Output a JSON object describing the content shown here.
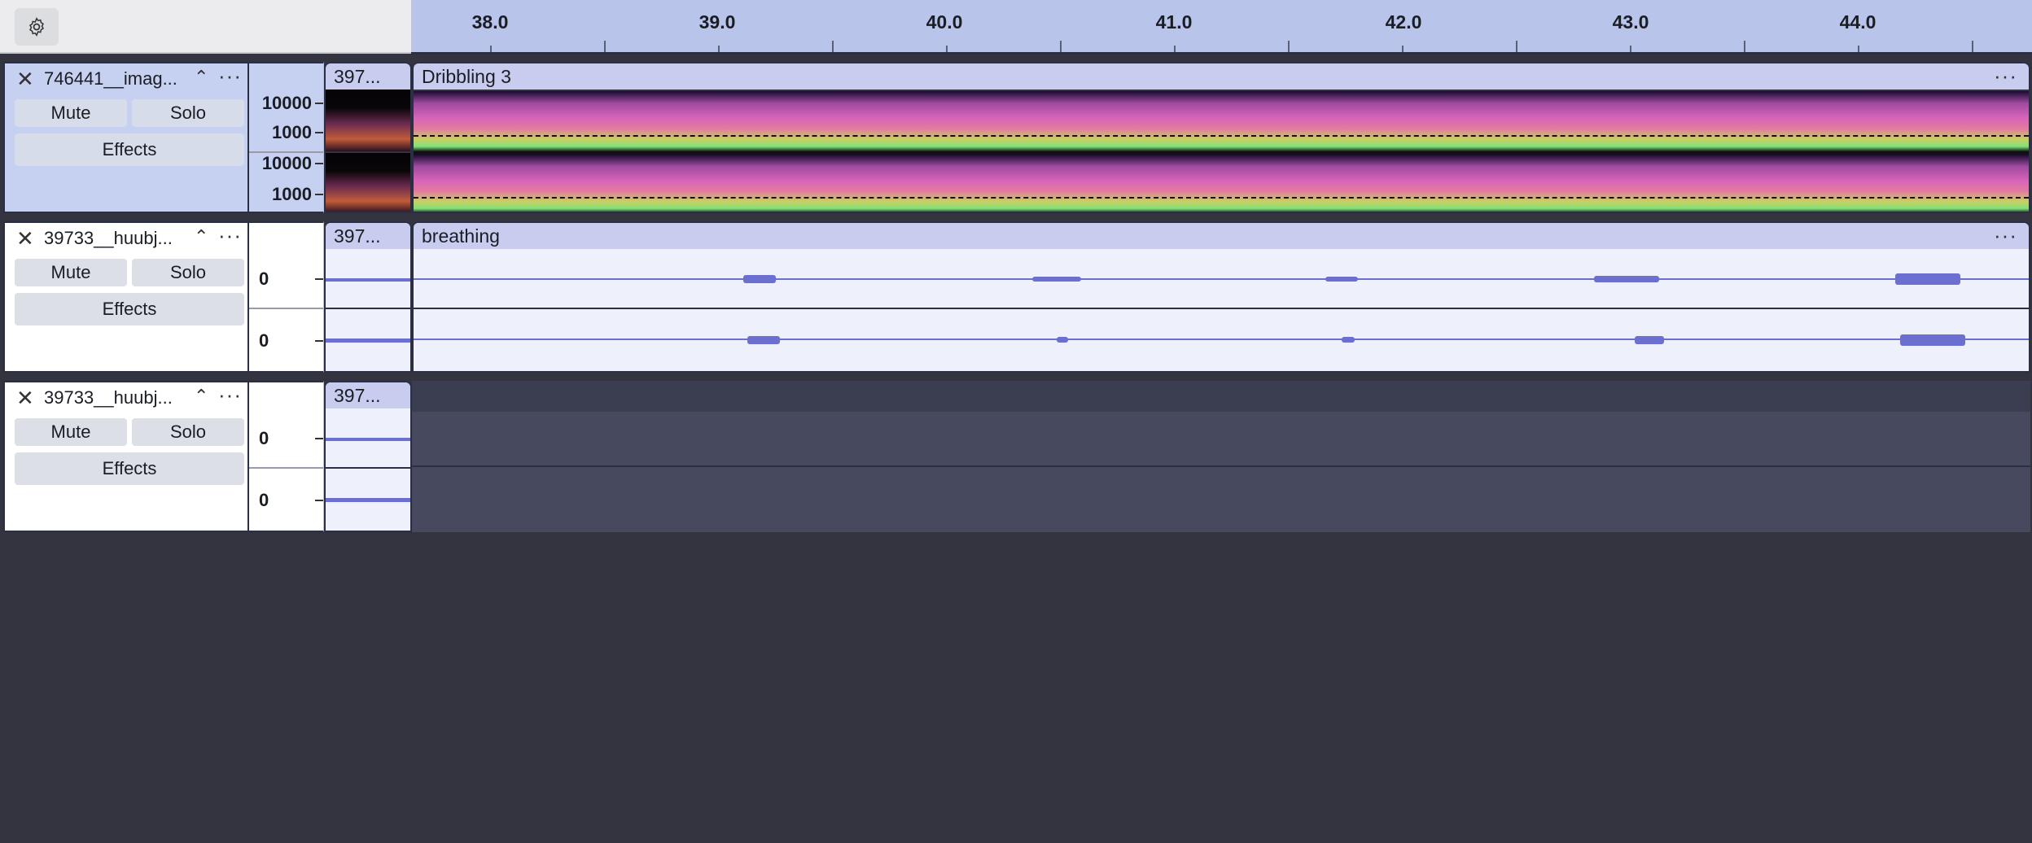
{
  "toolbar": {
    "settings_icon": "gear-icon"
  },
  "ruler": {
    "labels": [
      "38.0",
      "39.0",
      "40.0",
      "41.0",
      "42.0",
      "43.0",
      "44.0"
    ]
  },
  "tracks": [
    {
      "name": "746441__imag...",
      "mute_label": "Mute",
      "solo_label": "Solo",
      "effects_label": "Effects",
      "view": "spectrogram",
      "scale_labels": [
        "10000",
        "1000",
        "10000",
        "1000"
      ],
      "clips": [
        {
          "name": "397..."
        },
        {
          "name": "Dribbling 3",
          "menu": "···"
        }
      ]
    },
    {
      "name": "39733__huubj...",
      "mute_label": "Mute",
      "solo_label": "Solo",
      "effects_label": "Effects",
      "view": "waveform",
      "scale_labels": [
        "0",
        "0"
      ],
      "clips": [
        {
          "name": "397..."
        },
        {
          "name": "breathing",
          "menu": "···"
        }
      ]
    },
    {
      "name": "39733__huubj...",
      "mute_label": "Mute",
      "solo_label": "Solo",
      "effects_label": "Effects",
      "view": "waveform",
      "scale_labels": [
        "0",
        "0"
      ],
      "clips": [
        {
          "name": "397..."
        }
      ]
    }
  ],
  "common": {
    "close_glyph": "✕",
    "collapse_glyph": "⌃",
    "menu_glyph": "···"
  },
  "colors": {
    "ruler_bg": "#b9c4ea",
    "selected_track": "#c6d0f0",
    "clip_header": "#c8cdf0",
    "waveform": "#6a6fd0",
    "background": "#33343f"
  }
}
